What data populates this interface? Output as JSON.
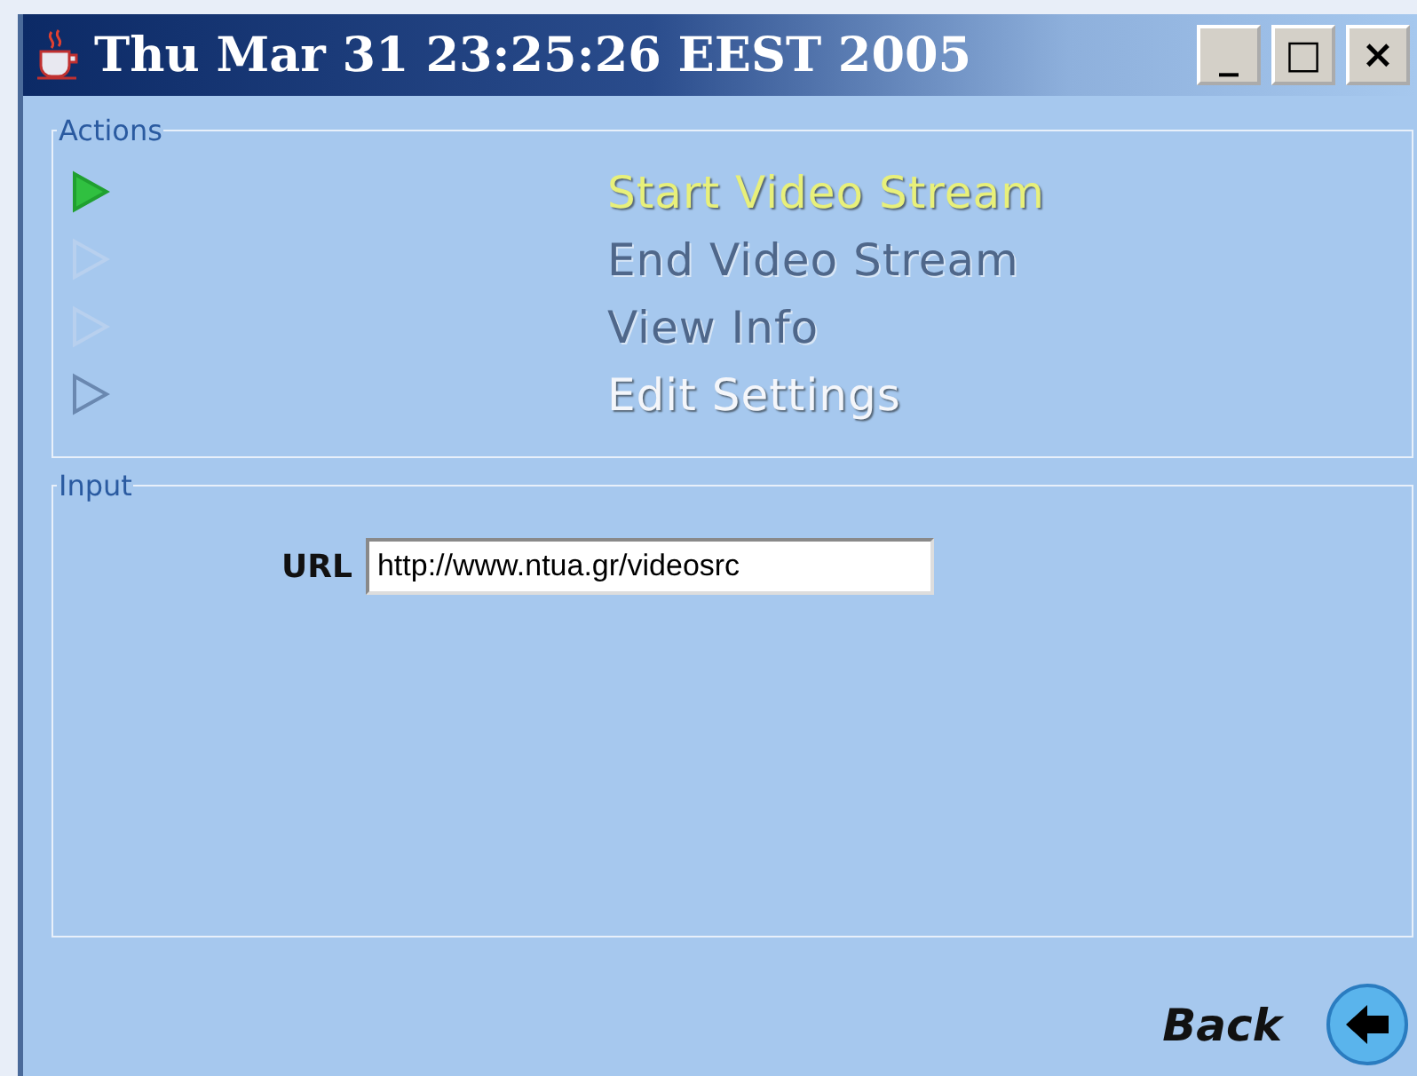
{
  "window": {
    "title": "Thu Mar 31 23:25:26 EEST 2005",
    "controls": [
      "_",
      "□",
      "×"
    ]
  },
  "actions": {
    "label": "Actions",
    "items": [
      {
        "label": "Start Video Stream",
        "highlighted": true,
        "disabled": false
      },
      {
        "label": "End Video Stream",
        "highlighted": false,
        "disabled": true
      },
      {
        "label": "View Info",
        "highlighted": false,
        "disabled": true
      },
      {
        "label": "Edit Settings",
        "highlighted": false,
        "disabled": false
      }
    ]
  },
  "input": {
    "label": "Input",
    "field_label": "URL",
    "value": "http://www.ntua.gr/videosrc"
  },
  "back": {
    "label": "Back"
  }
}
